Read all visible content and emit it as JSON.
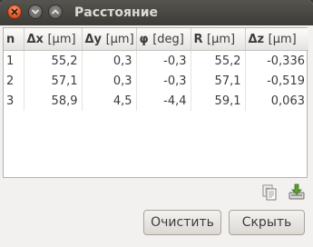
{
  "window": {
    "title": "Расстояние"
  },
  "table": {
    "headers": [
      {
        "sym": "n",
        "unit": ""
      },
      {
        "sym": "Δx",
        "unit": "[μm]"
      },
      {
        "sym": "Δy",
        "unit": "[μm]"
      },
      {
        "sym": "φ",
        "unit": "[deg]"
      },
      {
        "sym": "R",
        "unit": "[μm]"
      },
      {
        "sym": "Δz",
        "unit": "[μm]"
      }
    ],
    "rows": [
      [
        "1",
        "55,2",
        "0,3",
        "-0,3",
        "55,2",
        "-0,336"
      ],
      [
        "2",
        "57,1",
        "0,3",
        "-0,3",
        "57,1",
        "-0,519"
      ],
      [
        "3",
        "58,9",
        "4,5",
        "-4,4",
        "59,1",
        "0,063"
      ]
    ]
  },
  "icons": {
    "copy": "copy-icon",
    "save": "save-icon"
  },
  "buttons": {
    "clear": "Очистить",
    "hide": "Скрыть"
  },
  "colors": {
    "close_button": "#e35a28",
    "titlebar": "#3c3b37",
    "title_text": "#dfdbd2"
  }
}
